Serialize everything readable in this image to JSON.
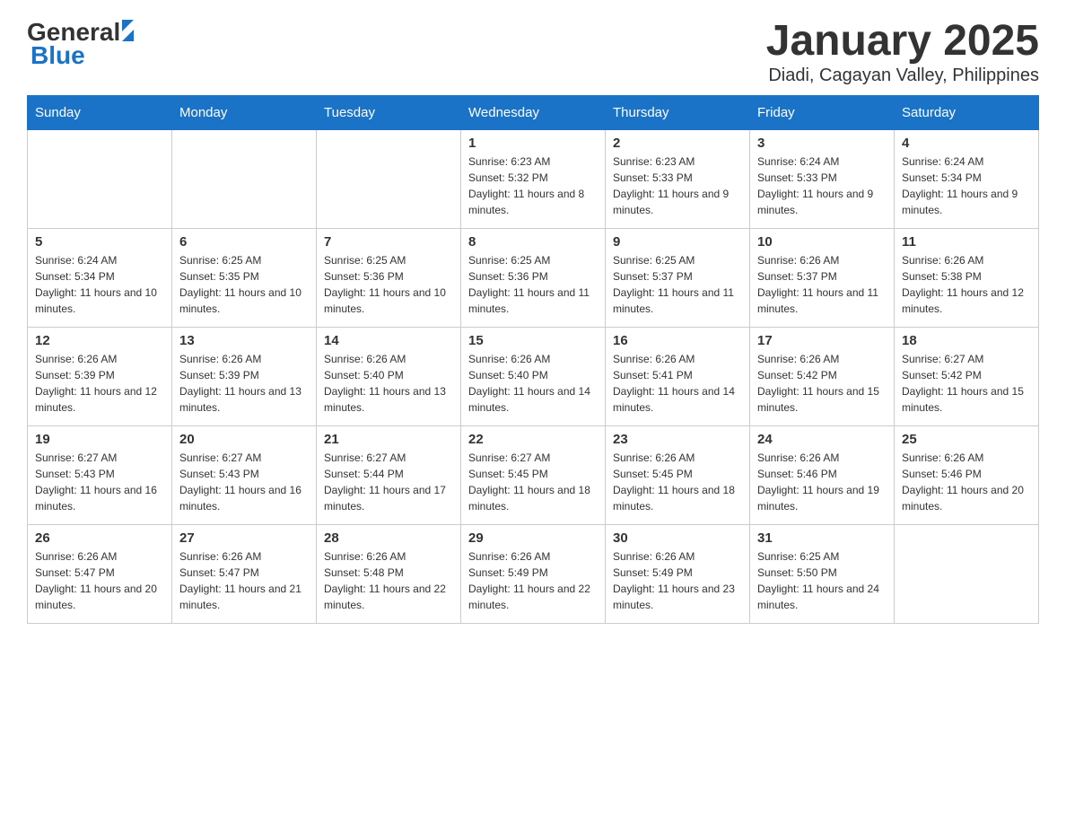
{
  "header": {
    "logo_general": "General",
    "logo_blue": "Blue",
    "title": "January 2025",
    "subtitle": "Diadi, Cagayan Valley, Philippines"
  },
  "days_of_week": [
    "Sunday",
    "Monday",
    "Tuesday",
    "Wednesday",
    "Thursday",
    "Friday",
    "Saturday"
  ],
  "weeks": [
    [
      {
        "day": "",
        "info": ""
      },
      {
        "day": "",
        "info": ""
      },
      {
        "day": "",
        "info": ""
      },
      {
        "day": "1",
        "info": "Sunrise: 6:23 AM\nSunset: 5:32 PM\nDaylight: 11 hours and 8 minutes."
      },
      {
        "day": "2",
        "info": "Sunrise: 6:23 AM\nSunset: 5:33 PM\nDaylight: 11 hours and 9 minutes."
      },
      {
        "day": "3",
        "info": "Sunrise: 6:24 AM\nSunset: 5:33 PM\nDaylight: 11 hours and 9 minutes."
      },
      {
        "day": "4",
        "info": "Sunrise: 6:24 AM\nSunset: 5:34 PM\nDaylight: 11 hours and 9 minutes."
      }
    ],
    [
      {
        "day": "5",
        "info": "Sunrise: 6:24 AM\nSunset: 5:34 PM\nDaylight: 11 hours and 10 minutes."
      },
      {
        "day": "6",
        "info": "Sunrise: 6:25 AM\nSunset: 5:35 PM\nDaylight: 11 hours and 10 minutes."
      },
      {
        "day": "7",
        "info": "Sunrise: 6:25 AM\nSunset: 5:36 PM\nDaylight: 11 hours and 10 minutes."
      },
      {
        "day": "8",
        "info": "Sunrise: 6:25 AM\nSunset: 5:36 PM\nDaylight: 11 hours and 11 minutes."
      },
      {
        "day": "9",
        "info": "Sunrise: 6:25 AM\nSunset: 5:37 PM\nDaylight: 11 hours and 11 minutes."
      },
      {
        "day": "10",
        "info": "Sunrise: 6:26 AM\nSunset: 5:37 PM\nDaylight: 11 hours and 11 minutes."
      },
      {
        "day": "11",
        "info": "Sunrise: 6:26 AM\nSunset: 5:38 PM\nDaylight: 11 hours and 12 minutes."
      }
    ],
    [
      {
        "day": "12",
        "info": "Sunrise: 6:26 AM\nSunset: 5:39 PM\nDaylight: 11 hours and 12 minutes."
      },
      {
        "day": "13",
        "info": "Sunrise: 6:26 AM\nSunset: 5:39 PM\nDaylight: 11 hours and 13 minutes."
      },
      {
        "day": "14",
        "info": "Sunrise: 6:26 AM\nSunset: 5:40 PM\nDaylight: 11 hours and 13 minutes."
      },
      {
        "day": "15",
        "info": "Sunrise: 6:26 AM\nSunset: 5:40 PM\nDaylight: 11 hours and 14 minutes."
      },
      {
        "day": "16",
        "info": "Sunrise: 6:26 AM\nSunset: 5:41 PM\nDaylight: 11 hours and 14 minutes."
      },
      {
        "day": "17",
        "info": "Sunrise: 6:26 AM\nSunset: 5:42 PM\nDaylight: 11 hours and 15 minutes."
      },
      {
        "day": "18",
        "info": "Sunrise: 6:27 AM\nSunset: 5:42 PM\nDaylight: 11 hours and 15 minutes."
      }
    ],
    [
      {
        "day": "19",
        "info": "Sunrise: 6:27 AM\nSunset: 5:43 PM\nDaylight: 11 hours and 16 minutes."
      },
      {
        "day": "20",
        "info": "Sunrise: 6:27 AM\nSunset: 5:43 PM\nDaylight: 11 hours and 16 minutes."
      },
      {
        "day": "21",
        "info": "Sunrise: 6:27 AM\nSunset: 5:44 PM\nDaylight: 11 hours and 17 minutes."
      },
      {
        "day": "22",
        "info": "Sunrise: 6:27 AM\nSunset: 5:45 PM\nDaylight: 11 hours and 18 minutes."
      },
      {
        "day": "23",
        "info": "Sunrise: 6:26 AM\nSunset: 5:45 PM\nDaylight: 11 hours and 18 minutes."
      },
      {
        "day": "24",
        "info": "Sunrise: 6:26 AM\nSunset: 5:46 PM\nDaylight: 11 hours and 19 minutes."
      },
      {
        "day": "25",
        "info": "Sunrise: 6:26 AM\nSunset: 5:46 PM\nDaylight: 11 hours and 20 minutes."
      }
    ],
    [
      {
        "day": "26",
        "info": "Sunrise: 6:26 AM\nSunset: 5:47 PM\nDaylight: 11 hours and 20 minutes."
      },
      {
        "day": "27",
        "info": "Sunrise: 6:26 AM\nSunset: 5:47 PM\nDaylight: 11 hours and 21 minutes."
      },
      {
        "day": "28",
        "info": "Sunrise: 6:26 AM\nSunset: 5:48 PM\nDaylight: 11 hours and 22 minutes."
      },
      {
        "day": "29",
        "info": "Sunrise: 6:26 AM\nSunset: 5:49 PM\nDaylight: 11 hours and 22 minutes."
      },
      {
        "day": "30",
        "info": "Sunrise: 6:26 AM\nSunset: 5:49 PM\nDaylight: 11 hours and 23 minutes."
      },
      {
        "day": "31",
        "info": "Sunrise: 6:25 AM\nSunset: 5:50 PM\nDaylight: 11 hours and 24 minutes."
      },
      {
        "day": "",
        "info": ""
      }
    ]
  ]
}
